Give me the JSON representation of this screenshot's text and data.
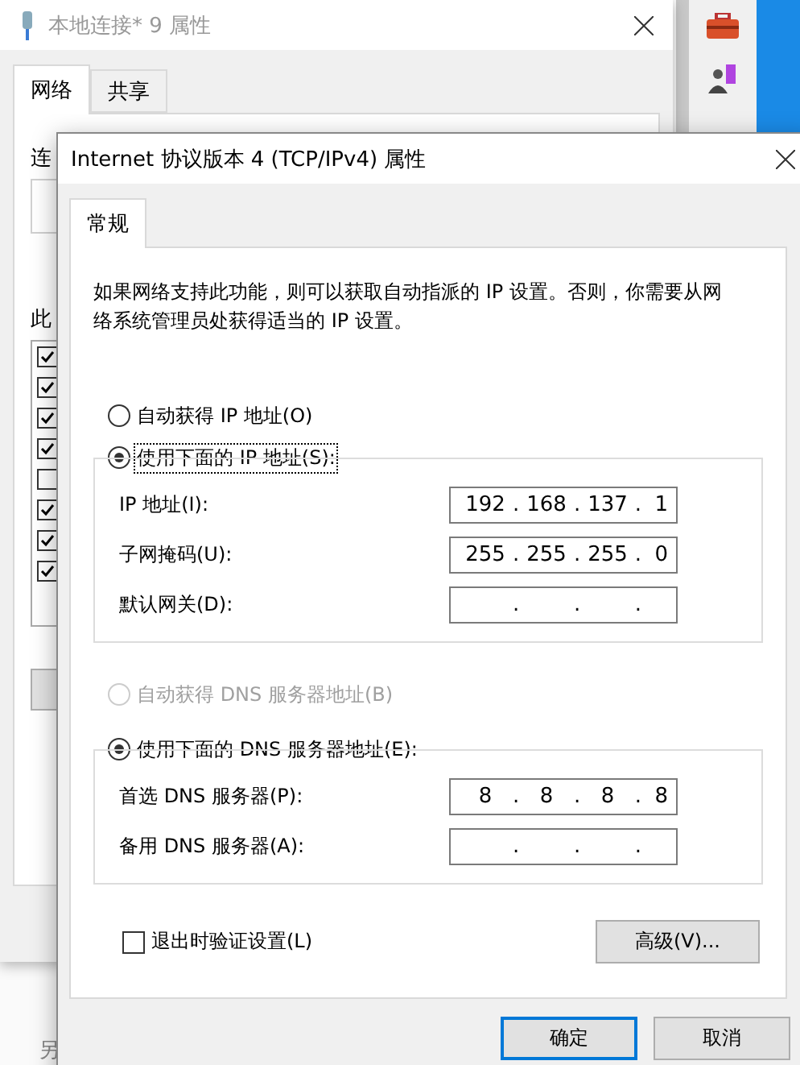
{
  "background_window": {
    "title": "本地连接* 9 属性",
    "tabs": [
      {
        "label": "网络",
        "selected": true
      },
      {
        "label": "共享",
        "selected": false
      }
    ],
    "connect_label": "连",
    "items_label": "此",
    "items": [
      {
        "checked": true
      },
      {
        "checked": true
      },
      {
        "checked": true
      },
      {
        "checked": true
      },
      {
        "checked": false
      },
      {
        "checked": true
      },
      {
        "checked": true
      },
      {
        "checked": true
      }
    ]
  },
  "desktop_text": "另",
  "dialog": {
    "title": "Internet 协议版本 4 (TCP/IPv4) 属性",
    "tabs": [
      {
        "label": "常规",
        "selected": true
      }
    ],
    "description": "如果网络支持此功能，则可以获取自动指派的 IP 设置。否则，你需要从网络系统管理员处获得适当的 IP 设置。",
    "ip_mode": [
      {
        "label": "自动获得 IP 地址(O)",
        "selected": false,
        "disabled": false,
        "focused": false
      },
      {
        "label": "使用下面的 IP 地址(S):",
        "selected": true,
        "disabled": false,
        "focused": true
      }
    ],
    "ip_fields": [
      {
        "label": "IP 地址(I):",
        "octets": [
          "192",
          "168",
          "137",
          "1"
        ],
        "separators": [
          ".",
          ".",
          "."
        ]
      },
      {
        "label": "子网掩码(U):",
        "octets": [
          "255",
          "255",
          "255",
          "0"
        ],
        "separators": [
          ".",
          ".",
          "."
        ]
      },
      {
        "label": "默认网关(D):",
        "separators": [
          ".",
          ".",
          "."
        ]
      }
    ],
    "dns_mode": [
      {
        "label": "自动获得 DNS 服务器地址(B)",
        "selected": false,
        "disabled": true,
        "focused": false
      },
      {
        "label": "使用下面的 DNS 服务器地址(E):",
        "selected": true,
        "disabled": false,
        "focused": false
      }
    ],
    "dns_fields": [
      {
        "label": "首选 DNS 服务器(P):",
        "octets": [
          "8",
          "8",
          "8",
          "8"
        ],
        "separators": [
          ".",
          ".",
          "."
        ]
      },
      {
        "label": "备用 DNS 服务器(A):",
        "separators": [
          ".",
          ".",
          "."
        ]
      }
    ],
    "validate_on_exit": {
      "label": "退出时验证设置(L)",
      "checked": false
    },
    "advanced_button": "高级(V)...",
    "buttons": [
      {
        "label": "确定",
        "default": true
      },
      {
        "label": "取消",
        "default": false
      }
    ]
  }
}
